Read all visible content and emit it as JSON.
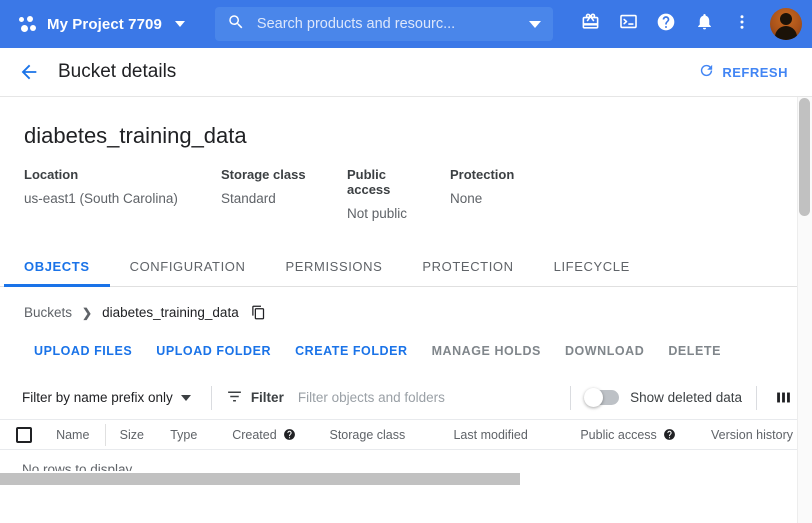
{
  "topbar": {
    "project_icon": "project-dots-icon",
    "project_name": "My Project 7709",
    "project_caret": "chevron-down-icon",
    "search": {
      "icon": "search-icon",
      "placeholder": "Search products and resourc...",
      "value": "",
      "caret": "chevron-down-icon"
    },
    "actions": [
      {
        "icon": "gift-icon",
        "name": "promotions-button"
      },
      {
        "icon": "cloud-shell-icon",
        "name": "cloud-shell-button"
      },
      {
        "icon": "help-icon",
        "name": "help-button"
      },
      {
        "icon": "bell-icon",
        "name": "notifications-button"
      },
      {
        "icon": "more-vert-icon",
        "name": "more-options-button"
      }
    ],
    "avatar": "user-avatar",
    "bg_color": "#3b78e7"
  },
  "pagehead": {
    "back_icon": "arrow-back-icon",
    "title": "Bucket details",
    "refresh_icon": "refresh-icon",
    "refresh_label": "REFRESH",
    "accent_color": "#4285f4"
  },
  "bucket": {
    "name": "diabetes_training_data",
    "meta": [
      {
        "label": "Location",
        "value": "us-east1 (South Carolina)"
      },
      {
        "label": "Storage class",
        "value": "Standard"
      },
      {
        "label": "Public access",
        "value": "Not public"
      },
      {
        "label": "Protection",
        "value": "None"
      }
    ]
  },
  "tabs": [
    {
      "label": "OBJECTS",
      "active": true
    },
    {
      "label": "CONFIGURATION",
      "active": false
    },
    {
      "label": "PERMISSIONS",
      "active": false
    },
    {
      "label": "PROTECTION",
      "active": false
    },
    {
      "label": "LIFECYCLE",
      "active": false
    }
  ],
  "breadcrumb": {
    "root": "Buckets",
    "separator": "❯",
    "current": "diabetes_training_data",
    "copy_icon": "copy-icon"
  },
  "actions": [
    {
      "label": "UPLOAD FILES",
      "enabled": true
    },
    {
      "label": "UPLOAD FOLDER",
      "enabled": true
    },
    {
      "label": "CREATE FOLDER",
      "enabled": true
    },
    {
      "label": "MANAGE HOLDS",
      "enabled": false
    },
    {
      "label": "DOWNLOAD",
      "enabled": false
    },
    {
      "label": "DELETE",
      "enabled": false
    }
  ],
  "filterbar": {
    "prefix_select_label": "Filter by name prefix only",
    "prefix_caret": "chevron-down-icon",
    "filter_icon": "filter-list-icon",
    "filter_label": "Filter",
    "filter_placeholder": "Filter objects and folders",
    "filter_value": "",
    "toggle_state": "off",
    "toggle_label": "Show deleted data",
    "columns_icon": "column-settings-icon"
  },
  "table": {
    "select_all_checkbox": "unchecked",
    "columns": [
      {
        "label": "Name",
        "help": false
      },
      {
        "label": "Size",
        "help": false
      },
      {
        "label": "Type",
        "help": false
      },
      {
        "label": "Created",
        "help": true
      },
      {
        "label": "Storage class",
        "help": false
      },
      {
        "label": "Last modified",
        "help": false
      },
      {
        "label": "Public access",
        "help": true
      },
      {
        "label": "Version history",
        "help": true
      }
    ],
    "rows": [],
    "empty_message": "No rows to display"
  }
}
